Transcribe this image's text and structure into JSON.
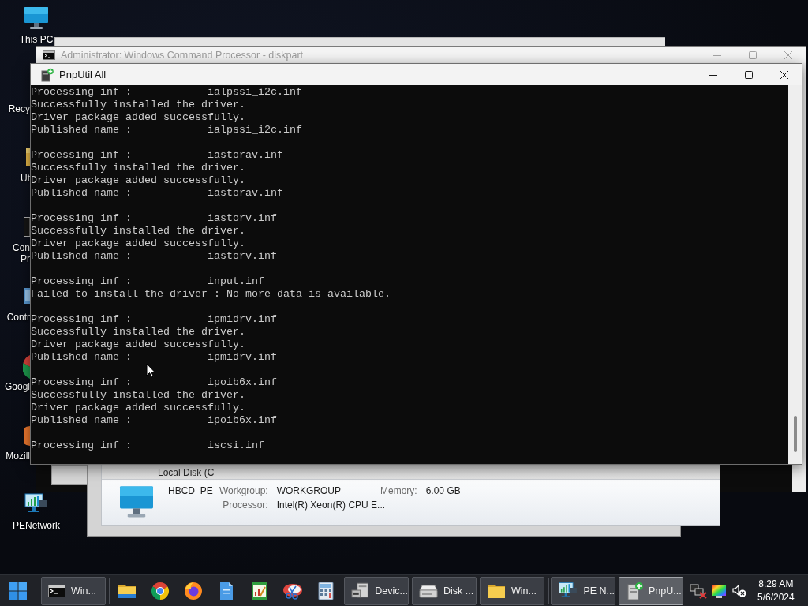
{
  "desktop_icons": [
    {
      "label_lines": [
        "This PC"
      ],
      "covered": false
    },
    {
      "label_lines": [
        "Recy"
      ],
      "covered": true
    },
    {
      "label_lines": [
        "Ut"
      ],
      "covered": true
    },
    {
      "label_lines": [
        "Con",
        "Pr"
      ],
      "covered": true
    },
    {
      "label_lines": [
        "Contr"
      ],
      "covered": true
    },
    {
      "label_lines": [
        "Googl"
      ],
      "covered": true
    },
    {
      "label_lines": [
        "Mozill"
      ],
      "covered": true
    },
    {
      "label_lines": [
        "PENetwork"
      ],
      "covered": false
    }
  ],
  "cmd_window": {
    "title": "Administrator: Windows Command Processor - diskpart",
    "active": false
  },
  "explorer_window": {
    "tree_item": "Local Disk (C",
    "details": {
      "name": "HBCD_PE",
      "fields": [
        {
          "label": "Workgroup:",
          "value": "WORKGROUP"
        },
        {
          "label": "Memory:",
          "value": "6.00 GB"
        },
        {
          "label": "Processor:",
          "value": "Intel(R) Xeon(R) CPU E..."
        }
      ]
    }
  },
  "pnputil_window": {
    "title": "PnpUtil All",
    "active": true,
    "console": {
      "blocks": [
        {
          "lines": [
            {
              "kind": "field",
              "label": "Processing inf :",
              "value": "ialpssi_i2c.inf"
            },
            {
              "kind": "message",
              "text": "Successfully installed the driver."
            },
            {
              "kind": "message",
              "text": "Driver package added successfully."
            },
            {
              "kind": "field",
              "label": "Published name :",
              "value": "ialpssi_i2c.inf"
            }
          ]
        },
        {
          "lines": [
            {
              "kind": "field",
              "label": "Processing inf :",
              "value": "iastorav.inf"
            },
            {
              "kind": "message",
              "text": "Successfully installed the driver."
            },
            {
              "kind": "message",
              "text": "Driver package added successfully."
            },
            {
              "kind": "field",
              "label": "Published name :",
              "value": "iastorav.inf"
            }
          ]
        },
        {
          "lines": [
            {
              "kind": "field",
              "label": "Processing inf :",
              "value": "iastorv.inf"
            },
            {
              "kind": "message",
              "text": "Successfully installed the driver."
            },
            {
              "kind": "message",
              "text": "Driver package added successfully."
            },
            {
              "kind": "field",
              "label": "Published name :",
              "value": "iastorv.inf"
            }
          ]
        },
        {
          "lines": [
            {
              "kind": "field",
              "label": "Processing inf :",
              "value": "input.inf"
            },
            {
              "kind": "message",
              "text": "Failed to install the driver : No more data is available."
            }
          ]
        },
        {
          "lines": [
            {
              "kind": "field",
              "label": "Processing inf :",
              "value": "ipmidrv.inf"
            },
            {
              "kind": "message",
              "text": "Successfully installed the driver."
            },
            {
              "kind": "message",
              "text": "Driver package added successfully."
            },
            {
              "kind": "field",
              "label": "Published name :",
              "value": "ipmidrv.inf"
            }
          ]
        },
        {
          "lines": [
            {
              "kind": "field",
              "label": "Processing inf :",
              "value": "ipoib6x.inf"
            },
            {
              "kind": "message",
              "text": "Successfully installed the driver."
            },
            {
              "kind": "message",
              "text": "Driver package added successfully."
            },
            {
              "kind": "field",
              "label": "Published name :",
              "value": "ipoib6x.inf"
            }
          ]
        },
        {
          "lines": [
            {
              "kind": "field",
              "label": "Processing inf :",
              "value": "iscsi.inf"
            }
          ]
        }
      ]
    }
  },
  "taskbar": {
    "groups": [
      {
        "items": [
          {
            "kind": "start"
          },
          {
            "kind": "task",
            "label": "Win...",
            "selected": false
          }
        ]
      },
      {
        "items": [
          {
            "kind": "pinned"
          },
          {
            "kind": "pinned"
          },
          {
            "kind": "pinned"
          },
          {
            "kind": "pinned"
          },
          {
            "kind": "pinned"
          },
          {
            "kind": "pinned"
          },
          {
            "kind": "pinned"
          },
          {
            "kind": "task",
            "label": "Devic...",
            "selected": false
          },
          {
            "kind": "task",
            "label": "Disk ...",
            "selected": false
          },
          {
            "kind": "task",
            "label": "Win...",
            "selected": false
          }
        ]
      },
      {
        "items": [
          {
            "kind": "task",
            "label": "PE N...",
            "selected": false
          },
          {
            "kind": "task",
            "label": "PnpU...",
            "selected": true
          }
        ]
      }
    ],
    "clock": {
      "time": "8:29 AM",
      "date": "5/6/2024"
    }
  }
}
